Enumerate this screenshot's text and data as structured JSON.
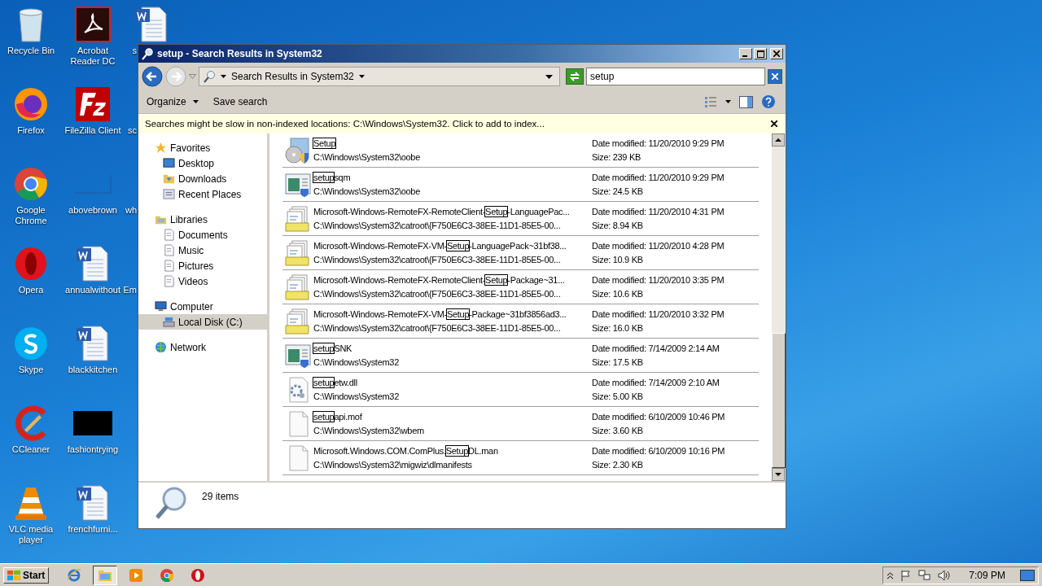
{
  "desktop_columns": [
    [
      {
        "label": "Recycle Bin",
        "kind": "recycle"
      },
      {
        "label": "Firefox",
        "kind": "firefox"
      },
      {
        "label": "Google Chrome",
        "kind": "chrome"
      },
      {
        "label": "Opera",
        "kind": "opera"
      },
      {
        "label": "Skype",
        "kind": "skype"
      },
      {
        "label": "CCleaner",
        "kind": "ccleaner"
      },
      {
        "label": "VLC media player",
        "kind": "vlc"
      }
    ],
    [
      {
        "label": "Acrobat Reader DC",
        "kind": "acrobat"
      },
      {
        "label": "FileZilla Client",
        "kind": "filezilla"
      },
      {
        "label": "abovebrown",
        "kind": "blank"
      },
      {
        "label": "annualwithout",
        "kind": "word"
      },
      {
        "label": "blackkitchen",
        "kind": "word"
      },
      {
        "label": "fashiontrying",
        "kind": "black"
      },
      {
        "label": "frenchfurni...",
        "kind": "word"
      }
    ],
    [
      {
        "label": "s",
        "kind": "word"
      },
      {
        "label": "sc"
      },
      {
        "label": "wh"
      },
      {
        "label": "Em"
      }
    ]
  ],
  "window": {
    "title": "setup - Search Results in System32",
    "address": "Search Results in System32",
    "search": {
      "value": "setup"
    },
    "commands": [
      "Organize",
      "Save search"
    ],
    "info_bar": "Searches might be slow in non-indexed locations: C:\\Windows\\System32. Click to add to index...",
    "nav": [
      {
        "label": "Favorites",
        "kind": "star",
        "children": [
          {
            "label": "Desktop",
            "kind": "desktop",
            "selected": false
          },
          {
            "label": "Downloads",
            "kind": "folder",
            "selected": false
          },
          {
            "label": "Recent Places",
            "kind": "recent",
            "selected": false
          }
        ]
      },
      {
        "label": "Libraries",
        "kind": "library",
        "children": [
          {
            "label": "Documents",
            "kind": "doc",
            "selected": false
          },
          {
            "label": "Music",
            "kind": "doc",
            "selected": false
          },
          {
            "label": "Pictures",
            "kind": "doc",
            "selected": false
          },
          {
            "label": "Videos",
            "kind": "doc",
            "selected": false
          }
        ]
      },
      {
        "label": "Computer",
        "kind": "computer",
        "children": [
          {
            "label": "Local Disk (C:)",
            "kind": "disk",
            "selected": true
          }
        ]
      },
      {
        "label": "Network",
        "kind": "network"
      }
    ],
    "results": [
      {
        "kind": "setup",
        "name": {
          "hit": "Setup"
        },
        "path": "C:\\Windows\\System32\\oobe",
        "date": "Date modified: 11/20/2010 9:29 PM",
        "size": "Size: 239 KB"
      },
      {
        "kind": "app",
        "name": {
          "hit": "setup",
          "post": "sqm"
        },
        "path": "C:\\Windows\\System32\\oobe",
        "date": "Date modified: 11/20/2010 9:29 PM",
        "size": "Size: 24.5 KB"
      },
      {
        "kind": "catalog",
        "name": {
          "pre": "Microsoft-Windows-RemoteFX-RemoteClient-",
          "hit": "Setup",
          "post": "-LanguagePac..."
        },
        "path": "C:\\Windows\\System32\\catroot\\{F750E6C3-38EE-11D1-85E5-00...",
        "date": "Date modified: 11/20/2010 4:31 PM",
        "size": "Size: 8.94 KB"
      },
      {
        "kind": "catalog",
        "name": {
          "pre": "Microsoft-Windows-RemoteFX-VM-",
          "hit": "Setup",
          "post": "-LanguagePack~31bf38..."
        },
        "path": "C:\\Windows\\System32\\catroot\\{F750E6C3-38EE-11D1-85E5-00...",
        "date": "Date modified: 11/20/2010 4:28 PM",
        "size": "Size: 10.9 KB"
      },
      {
        "kind": "catalog",
        "name": {
          "pre": "Microsoft-Windows-RemoteFX-RemoteClient-",
          "hit": "Setup",
          "post": "-Package~31..."
        },
        "path": "C:\\Windows\\System32\\catroot\\{F750E6C3-38EE-11D1-85E5-00...",
        "date": "Date modified: 11/20/2010 3:35 PM",
        "size": "Size: 10.6 KB"
      },
      {
        "kind": "catalog",
        "name": {
          "pre": "Microsoft-Windows-RemoteFX-VM-",
          "hit": "Setup",
          "post": "-Package~31bf3856ad3..."
        },
        "path": "C:\\Windows\\System32\\catroot\\{F750E6C3-38EE-11D1-85E5-00...",
        "date": "Date modified: 11/20/2010 3:32 PM",
        "size": "Size: 16.0 KB"
      },
      {
        "kind": "app",
        "name": {
          "hit": "setup",
          "post": "SNK"
        },
        "path": "C:\\Windows\\System32",
        "date": "Date modified: 7/14/2009 2:14 AM",
        "size": "Size: 17.5 KB"
      },
      {
        "kind": "dll",
        "name": {
          "hit": "setup",
          "post": "etw.dll"
        },
        "path": "C:\\Windows\\System32",
        "date": "Date modified: 7/14/2009 2:10 AM",
        "size": "Size: 5.00 KB"
      },
      {
        "kind": "blank",
        "name": {
          "hit": "setup",
          "post": "api.mof"
        },
        "path": "C:\\Windows\\System32\\wbem",
        "date": "Date modified: 6/10/2009 10:46 PM",
        "size": "Size: 3.60 KB"
      },
      {
        "kind": "blank",
        "name": {
          "pre": "Microsoft.Windows.COM.ComPlus.",
          "hit": "Setup",
          "post": "DL.man"
        },
        "path": "C:\\Windows\\System32\\migwiz\\dlmanifests",
        "date": "Date modified: 6/10/2009 10:16 PM",
        "size": "Size: 2.30 KB"
      }
    ],
    "item_count": "29 items"
  },
  "taskbar": {
    "start": "Start",
    "apps": [
      {
        "kind": "ie",
        "selected": false
      },
      {
        "kind": "explorer",
        "selected": true
      },
      {
        "kind": "media",
        "selected": false
      },
      {
        "kind": "chrome",
        "selected": false
      },
      {
        "kind": "opera",
        "selected": false
      }
    ],
    "clock": "7:09 PM"
  }
}
